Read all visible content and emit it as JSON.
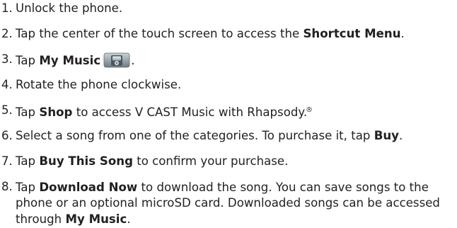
{
  "steps": [
    {
      "num": "1.",
      "text": "Unlock the phone."
    },
    {
      "num": "2.",
      "pre": "Tap the center of the touch screen to access the ",
      "bold": "Shortcut Menu",
      "post": "."
    },
    {
      "num": "3.",
      "pre": "Tap ",
      "bold": "My Music",
      "post": ".",
      "icon": "my-music-app-icon"
    },
    {
      "num": "4.",
      "text": "Rotate the phone clockwise."
    },
    {
      "num": "5.",
      "pre": "Tap ",
      "bold": "Shop",
      "post": " to access V CAST Music with Rhapsody.",
      "sup": "®"
    },
    {
      "num": "6.",
      "pre": "Select a song from one of the categories. To purchase it, tap ",
      "bold": "Buy",
      "post": "."
    },
    {
      "num": "7.",
      "pre": "Tap ",
      "bold": "Buy This Song",
      "post": " to confirm your purchase."
    },
    {
      "num": "8.",
      "pre": "Tap ",
      "bold": "Download Now",
      "mid": " to download the song. You can save songs to the phone or an optional microSD card. Downloaded songs can be accessed through ",
      "bold2": "My Music",
      "post": "."
    }
  ],
  "colors": {
    "text": "#231f20",
    "icon_top": "#b9c3c9",
    "icon_bottom": "#6f7b84"
  }
}
